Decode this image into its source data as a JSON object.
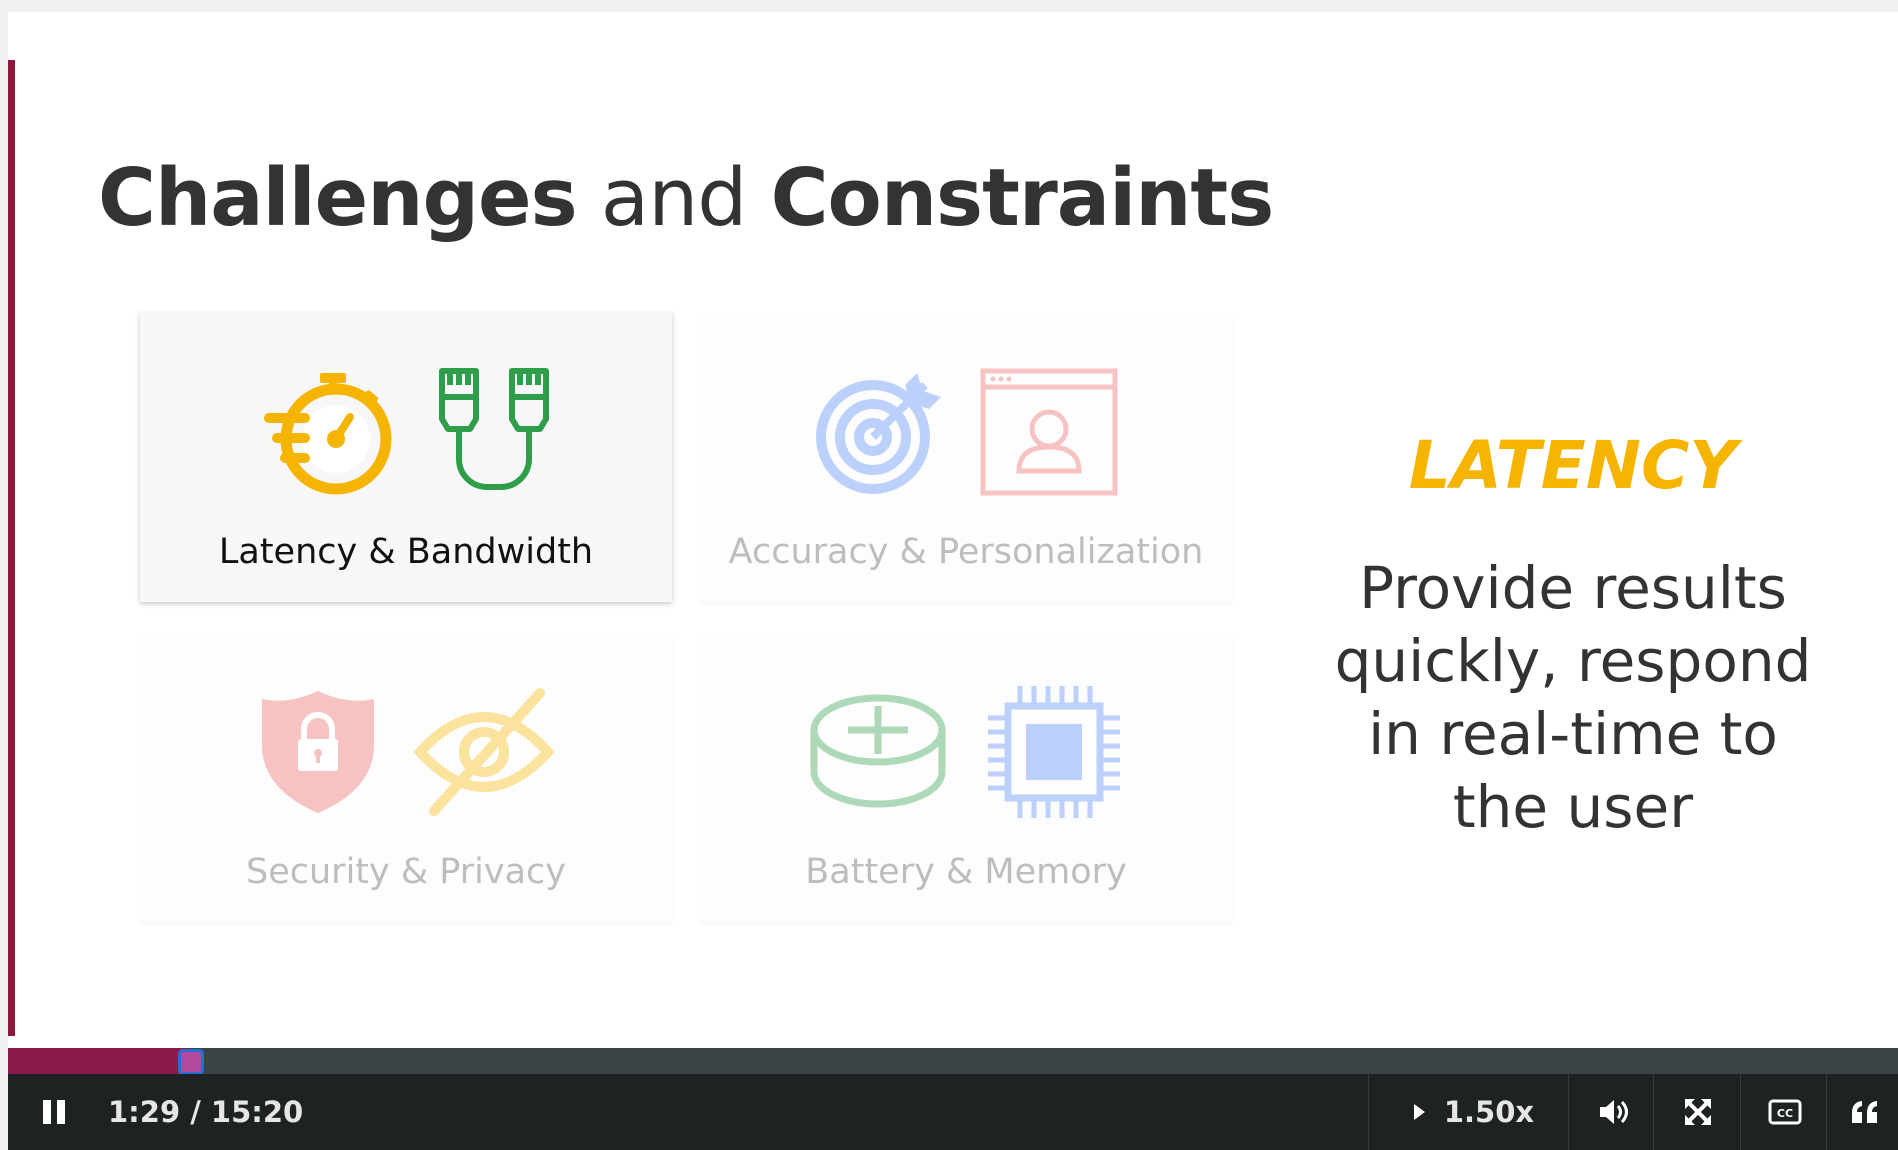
{
  "slide": {
    "title_part1": "Challenges",
    "title_part2": "and",
    "title_part3": "Constraints",
    "cards": [
      {
        "label": "Latency & Bandwidth",
        "icons": [
          "stopwatch-icon",
          "ethernet-cable-icon"
        ],
        "state": "active"
      },
      {
        "label": "Accuracy & Personalization",
        "icons": [
          "target-icon",
          "user-profile-window-icon"
        ],
        "state": "dim"
      },
      {
        "label": "Security & Privacy",
        "icons": [
          "lock-shield-icon",
          "hidden-eye-icon"
        ],
        "state": "dim"
      },
      {
        "label": "Battery & Memory",
        "icons": [
          "battery-icon",
          "chip-icon"
        ],
        "state": "dim"
      }
    ],
    "side_heading": "LATENCY",
    "side_description": "Provide results quickly, respond in real-time to the user",
    "colors": {
      "accent": "#8b1a3c",
      "yellow": "#f5b400",
      "green": "#2e9e48",
      "blue": "#4f86f7",
      "red": "#e86060"
    }
  },
  "player": {
    "time_display": "1:29 / 15:20",
    "progress_fraction": 0.097,
    "speed_label": "1.50x",
    "icons": [
      "pause-icon",
      "play-triangle-icon",
      "volume-icon",
      "fullscreen-icon",
      "captions-icon",
      "transcript-quote-icon"
    ]
  }
}
